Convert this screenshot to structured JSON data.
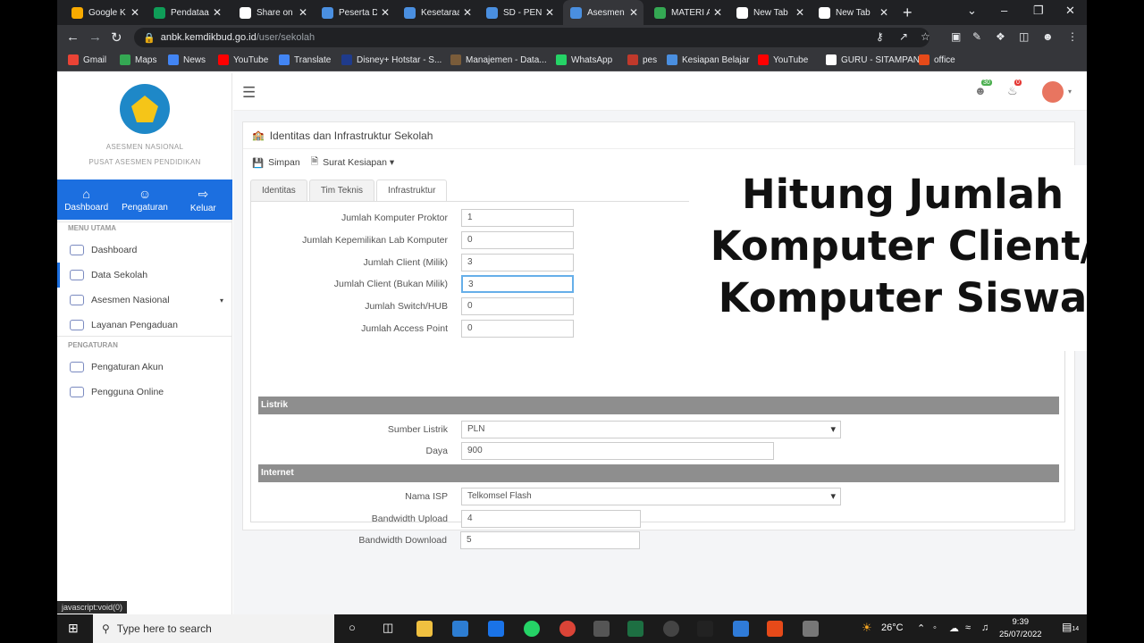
{
  "browser": {
    "tabs": [
      {
        "label": "Google K",
        "color": "#f9ab00",
        "active": false
      },
      {
        "label": "Pendataa",
        "color": "#0f9d58",
        "active": false
      },
      {
        "label": "Share on",
        "color": "#ffffff",
        "active": false
      },
      {
        "label": "Peserta D",
        "color": "#4a8fe0",
        "active": false
      },
      {
        "label": "Kesetaraa",
        "color": "#4a8fe0",
        "active": false
      },
      {
        "label": "SD - PEN",
        "color": "#4a8fe0",
        "active": false
      },
      {
        "label": "Asesmen",
        "color": "#4a8fe0",
        "active": true
      },
      {
        "label": "MATERI A",
        "color": "#34a853",
        "active": false
      },
      {
        "label": "New Tab",
        "color": "#ffffff",
        "active": false
      },
      {
        "label": "New Tab",
        "color": "#ffffff",
        "active": false
      }
    ],
    "url_host": "anbk.kemdikbud.go.id",
    "url_path": "/user/sekolah",
    "bookmarks": [
      {
        "label": "Gmail",
        "color": "#ea4335"
      },
      {
        "label": "Maps",
        "color": "#34a853"
      },
      {
        "label": "News",
        "color": "#4285f4"
      },
      {
        "label": "YouTube",
        "color": "#ff0000"
      },
      {
        "label": "Translate",
        "color": "#4285f4"
      },
      {
        "label": "Disney+ Hotstar - S...",
        "color": "#1f3b8c"
      },
      {
        "label": "Manajemen - Data...",
        "color": "#7a5c3a"
      },
      {
        "label": "WhatsApp",
        "color": "#25d366"
      },
      {
        "label": "pes",
        "color": "#c0392b"
      },
      {
        "label": "Kesiapan Belajar",
        "color": "#4a8fe0"
      },
      {
        "label": "YouTube",
        "color": "#ff0000"
      },
      {
        "label": "GURU - SITAMPAN",
        "color": "#ffffff"
      },
      {
        "label": "office",
        "color": "#e64a19"
      }
    ],
    "status_url": "javascript:void(0)"
  },
  "sidebar": {
    "org_line1": "ASESMEN NASIONAL",
    "org_line2": "PUSAT ASESMEN PENDIDIKAN",
    "quick": [
      {
        "label": "Dashboard",
        "icon": "home-icon",
        "glyph": "⌂"
      },
      {
        "label": "Pengaturan",
        "icon": "users-gear-icon",
        "glyph": "☺"
      },
      {
        "label": "Keluar",
        "icon": "sign-out-icon",
        "glyph": "⇨"
      }
    ],
    "section_main": "MENU UTAMA",
    "main_items": [
      {
        "label": "Dashboard",
        "active": false
      },
      {
        "label": "Data Sekolah",
        "active": true
      },
      {
        "label": "Asesmen Nasional",
        "active": false,
        "caret": true
      },
      {
        "label": "Layanan Pengaduan",
        "active": false
      }
    ],
    "section_settings": "PENGATURAN",
    "settings_items": [
      {
        "label": "Pengaturan Akun"
      },
      {
        "label": "Pengguna Online"
      }
    ]
  },
  "topbar": {
    "users_badge": "30",
    "bell_badge": "0"
  },
  "card": {
    "title": "Identitas dan Infrastruktur Sekolah",
    "save_label": "Simpan",
    "letter_label": "Surat Kesiapan",
    "tabs": [
      "Identitas",
      "Tim Teknis",
      "Infrastruktur"
    ],
    "active_tab": "Infrastruktur",
    "fields": [
      {
        "label": "Jumlah Komputer Proktor",
        "value": "1"
      },
      {
        "label": "Jumlah Kepemilikan Lab Komputer",
        "value": "0"
      },
      {
        "label": "Jumlah Client (Milik)",
        "value": "3"
      },
      {
        "label": "Jumlah Client (Bukan Milik)",
        "value": "3"
      },
      {
        "label": "Jumlah Switch/HUB",
        "value": "0"
      },
      {
        "label": "Jumlah Access Point",
        "value": "0"
      }
    ],
    "listrik_header": "Listrik",
    "sumber_listrik_label": "Sumber Listrik",
    "sumber_listrik_value": "PLN",
    "daya_label": "Daya",
    "daya_value": "900",
    "internet_header": "Internet",
    "isp_label": "Nama ISP",
    "isp_value": "Telkomsel Flash",
    "upload_label": "Bandwidth Upload",
    "upload_value": "4",
    "download_label": "Bandwidth Download",
    "download_value": "5"
  },
  "overlay": {
    "line1": "Hitung Jumlah",
    "line2": "Komputer Client/",
    "line3": "Komputer Siswa"
  },
  "taskbar": {
    "search_placeholder": "Type here to search",
    "weather": "26°C",
    "time": "9:39",
    "date": "25/07/2022",
    "notif_count": "14"
  }
}
